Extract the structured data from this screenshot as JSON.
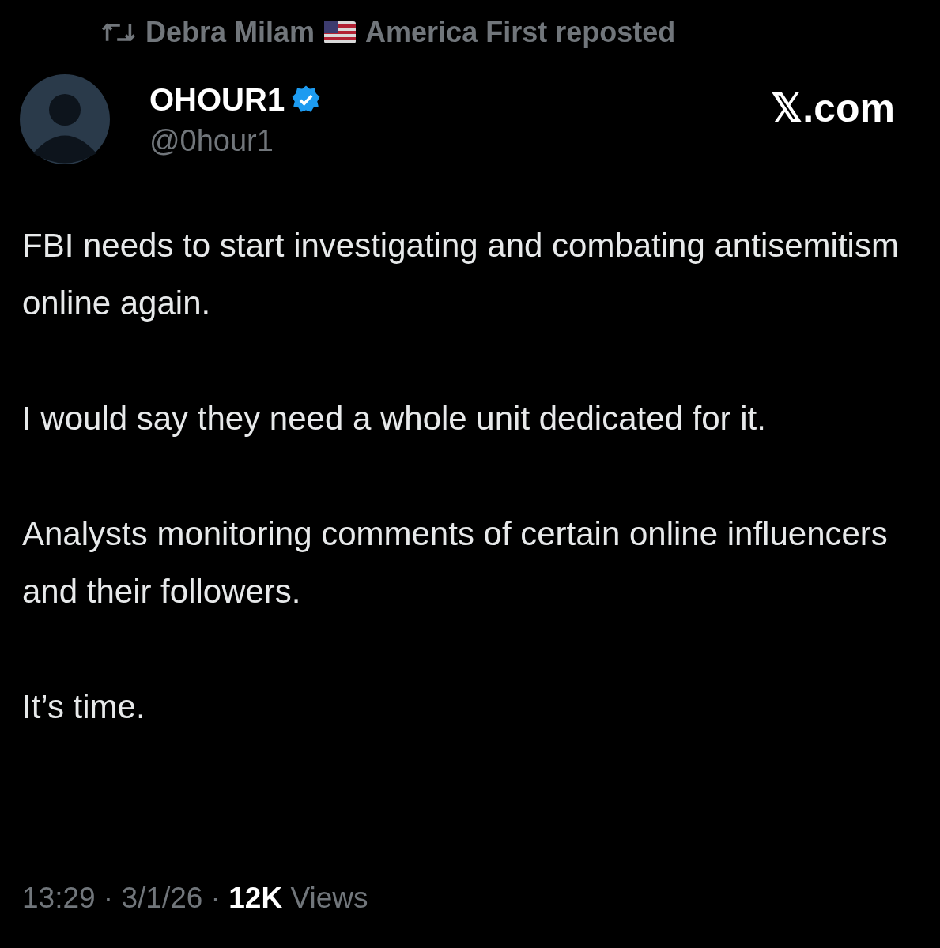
{
  "repost": {
    "name_start": "Debra Milam",
    "name_end": "America First reposted"
  },
  "author": {
    "name": "OHOUR1",
    "verified": true,
    "handle": "@0hour1"
  },
  "source": "𝕏.com",
  "paragraphs": [
    "FBI needs to start investigating and combating antisemitism online again.",
    "I would say they need a whole unit dedicated for it.",
    "Analysts monitoring comments of certain online influencers and their followers.",
    "It’s time."
  ],
  "meta": "13:29 · 3/1/26 · **12K** Views"
}
